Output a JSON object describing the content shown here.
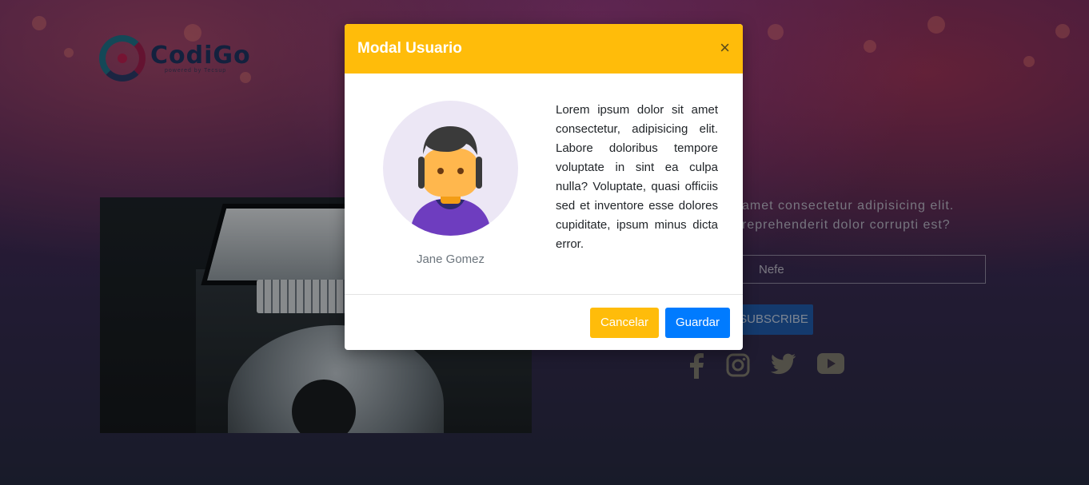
{
  "brand": {
    "logo_word": "CodiGo",
    "logo_sub": "powered by Tecsup"
  },
  "background": {
    "text_line1": "amet consectetur adipisicing elit.",
    "text_line2": "reprehenderit dolor corrupti est?",
    "input_placeholder": "Nefe",
    "subscribe_label": "SUBSCRIBE",
    "socials": [
      {
        "icon": "facebook-icon"
      },
      {
        "icon": "instagram-icon"
      },
      {
        "icon": "twitter-icon"
      },
      {
        "icon": "youtube-icon"
      }
    ]
  },
  "modal": {
    "title": "Modal Usuario",
    "close_label": "×",
    "user_name": "Jane Gomez",
    "description": "Lorem ipsum dolor sit amet consectetur, adipisicing elit. Labore doloribus tempore voluptate in sint ea culpa nulla? Voluptate, quasi officiis sed et inventore esse dolores cupiditate, ipsum minus dicta error.",
    "cancel_label": "Cancelar",
    "save_label": "Guardar",
    "colors": {
      "header": "#ffbc0a",
      "cancel": "#ffbc0a",
      "save": "#007bff"
    }
  }
}
